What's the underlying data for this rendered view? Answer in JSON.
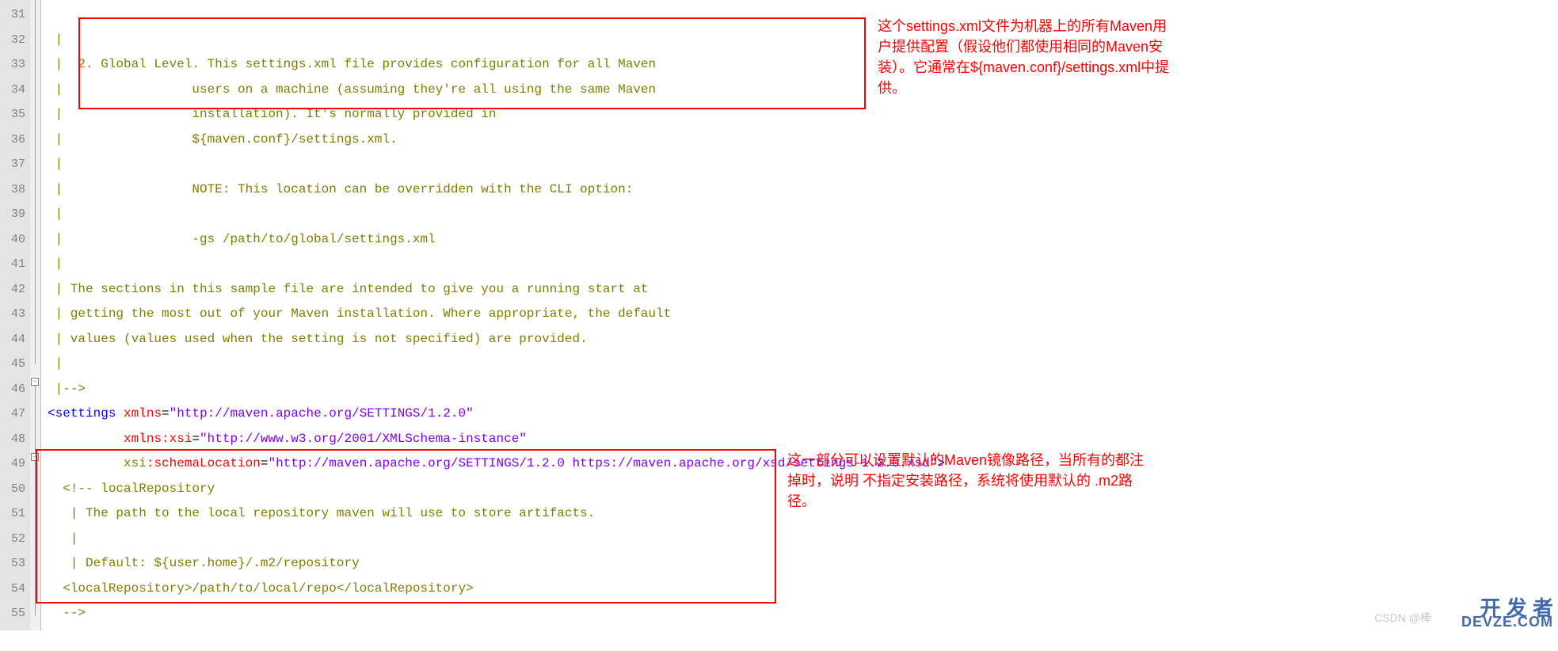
{
  "gutter": {
    "start": 31,
    "end": 55
  },
  "code": {
    "l31": " |",
    "l32": " |  2. Global Level. This settings.xml file provides configuration for all Maven",
    "l33": " |                 users on a machine (assuming they're all using the same Maven",
    "l34": " |                 installation). It's normally provided in",
    "l35": " |                 ${maven.conf}/settings.xml.",
    "l36": " |",
    "l37": " |                 NOTE: This location can be overridden with the CLI option:",
    "l38": " |",
    "l39": " |                 -gs /path/to/global/settings.xml",
    "l40": " |",
    "l41": " | The sections in this sample file are intended to give you a running start at",
    "l42": " | getting the most out of your Maven installation. Where appropriate, the default",
    "l43": " | values (values used when the setting is not specified) are provided.",
    "l44": " |",
    "l45": " |-->",
    "l46": {
      "open": "<",
      "tag": "settings",
      "sp": " ",
      "a1": "xmlns",
      "e1": "=",
      "v1": "\"http://maven.apache.org/SETTINGS/1.2.0\""
    },
    "l47": {
      "pad": "          ",
      "a": "xmlns:xsi",
      "e": "=",
      "v": "\"http://www.w3.org/2001/XMLSchema-instance\""
    },
    "l48": {
      "pad": "          ",
      "ns": "xsi",
      "c": ":",
      "a": "schemaLocation",
      "e": "=",
      "v": "\"http://maven.apache.org/SETTINGS/1.2.0 https://maven.apache.org/xsd/settings-1.2.0.xsd\"",
      "close": ">"
    },
    "l49": "  <!-- localRepository",
    "l50": "   | The path to the local repository maven will use to store artifacts.",
    "l51": "   |",
    "l52": "   | Default: ${user.home}/.m2/repository",
    "l53": "  <localRepository>/path/to/local/repo</localRepository>",
    "l54": "  -->"
  },
  "annotations": {
    "a1": "这个settings.xml文件为机器上的所有Maven用户提供配置（假设他们都使用相同的Maven安装）。它通常在${maven.conf}/settings.xml中提供。",
    "a2": "这一部分可以设置默认的Maven镜像路径，当所有的都注掉时，说明 不指定安装路径，系统将使用默认的 .m2路径。"
  },
  "watermark": {
    "w1": "CSDN @棒",
    "w2a": "开 发 者",
    "w2b": "DEVZE.COM"
  }
}
